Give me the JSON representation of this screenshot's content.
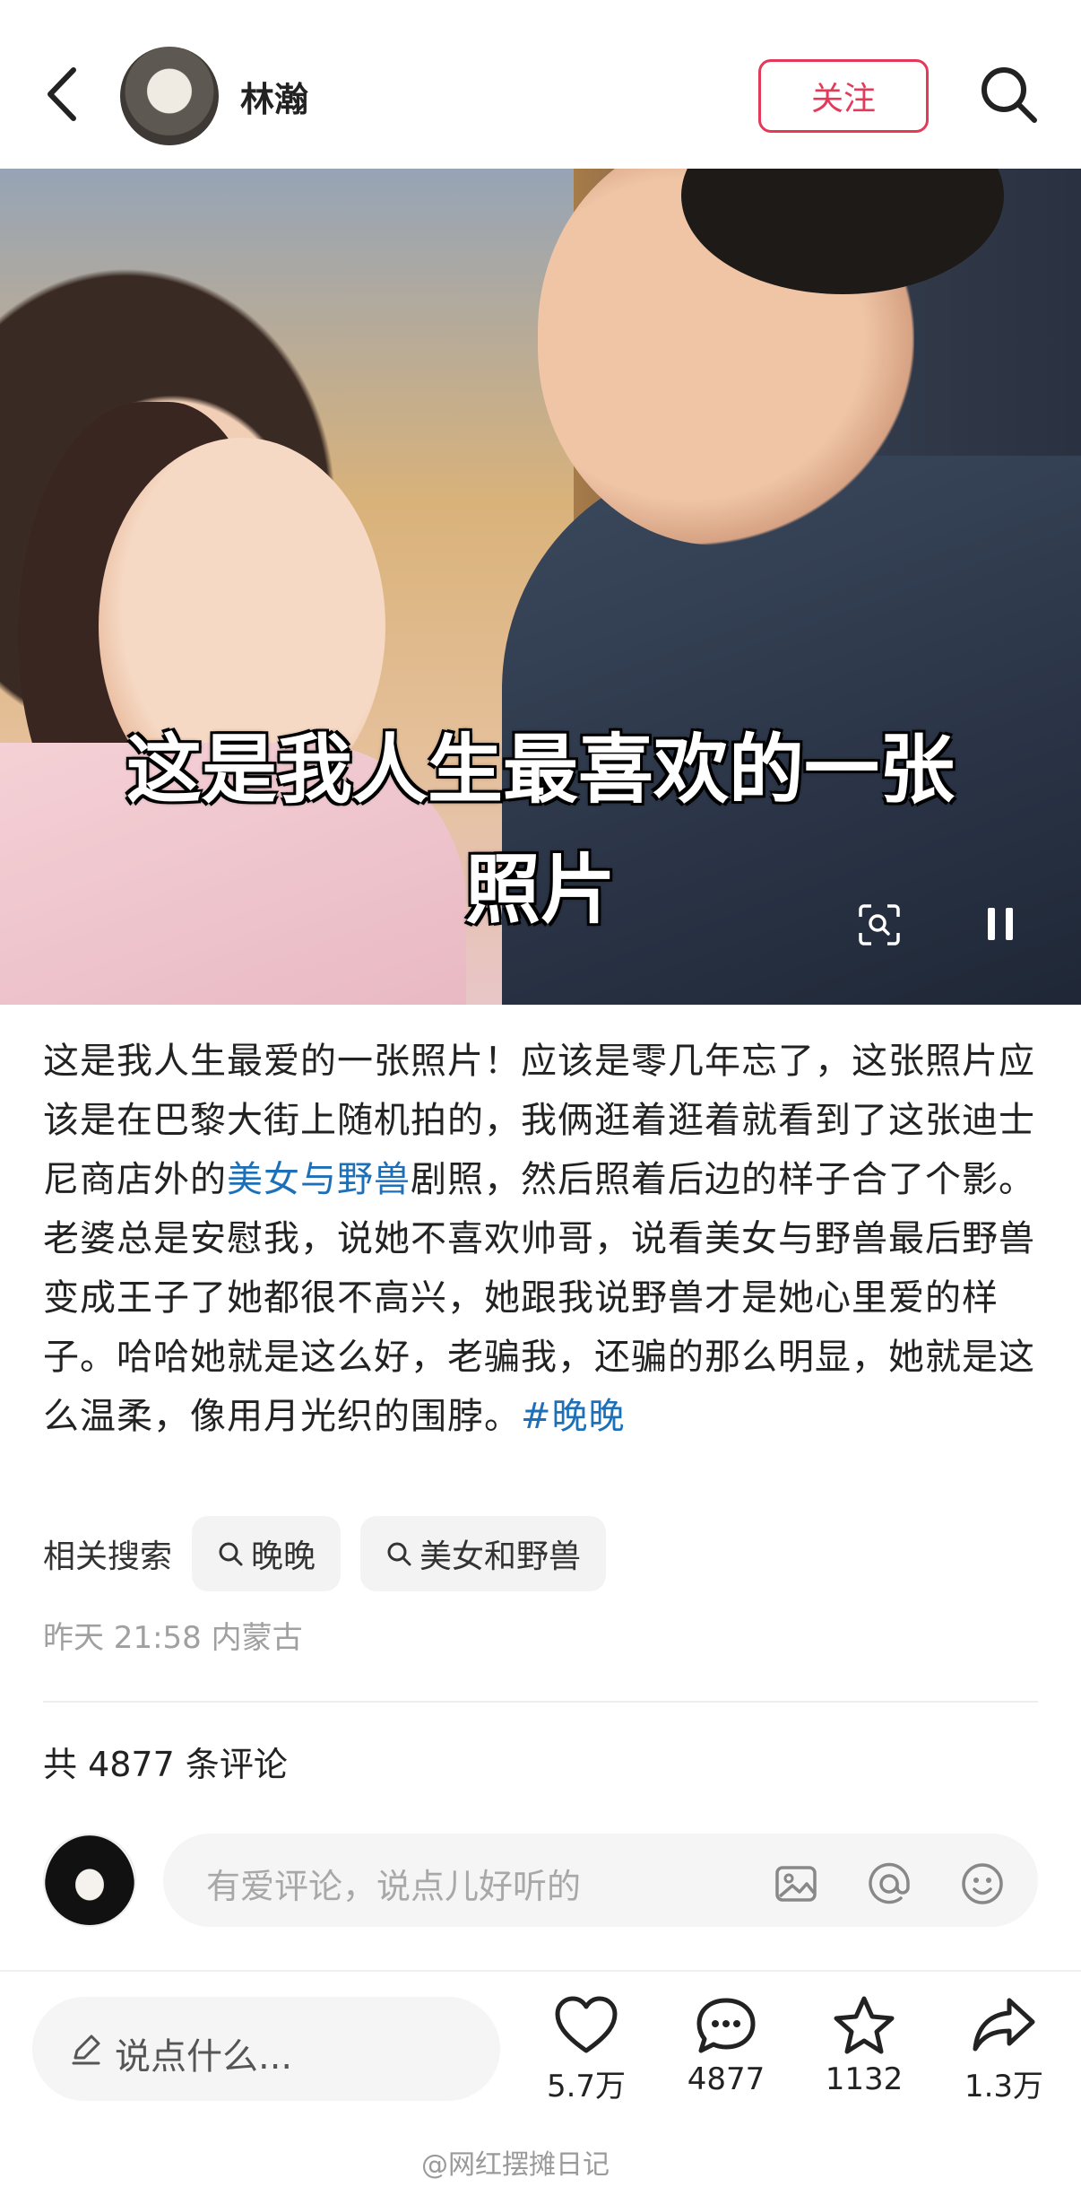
{
  "header": {
    "author_name": "林瀚",
    "follow_label": "关注"
  },
  "photo": {
    "overlay_line1": "这是我人生最喜欢的一张",
    "overlay_line2": "照片"
  },
  "caption": {
    "part1": "这是我人生最爱的一张照片！应该是零几年忘了，这张照片应该是在巴黎大街上随机拍的，我俩逛着逛着就看到了这张迪士尼商店外的",
    "link": "美女与野兽",
    "part2": "剧照，然后照着后边的样子合了个影。老婆总是安慰我，说她不喜欢帅哥，说看美女与野兽最后野兽变成王子了她都很不高兴，她跟我说野兽才是她心里爱的样子。哈哈她就是这么好，老骗我，还骗的那么明显，她就是这么温柔，像用月光织的围脖。",
    "hashtag": "#晚晚"
  },
  "related": {
    "label": "相关搜索",
    "chips": [
      "晚晚",
      "美女和野兽"
    ]
  },
  "meta": {
    "time_location": "昨天 21:58  内蒙古"
  },
  "comments": {
    "count_label": "共 4877 条评论",
    "input_placeholder": "有爱评论，说点儿好听的"
  },
  "bottom_bar": {
    "say_placeholder": "说点什么...",
    "likes": "5.7万",
    "comments": "4877",
    "favorites": "1132",
    "shares": "1.3万"
  },
  "watermark": "@网红摆摊日记",
  "colors": {
    "accent": "#e33a5a",
    "link": "#1d6fb8"
  }
}
